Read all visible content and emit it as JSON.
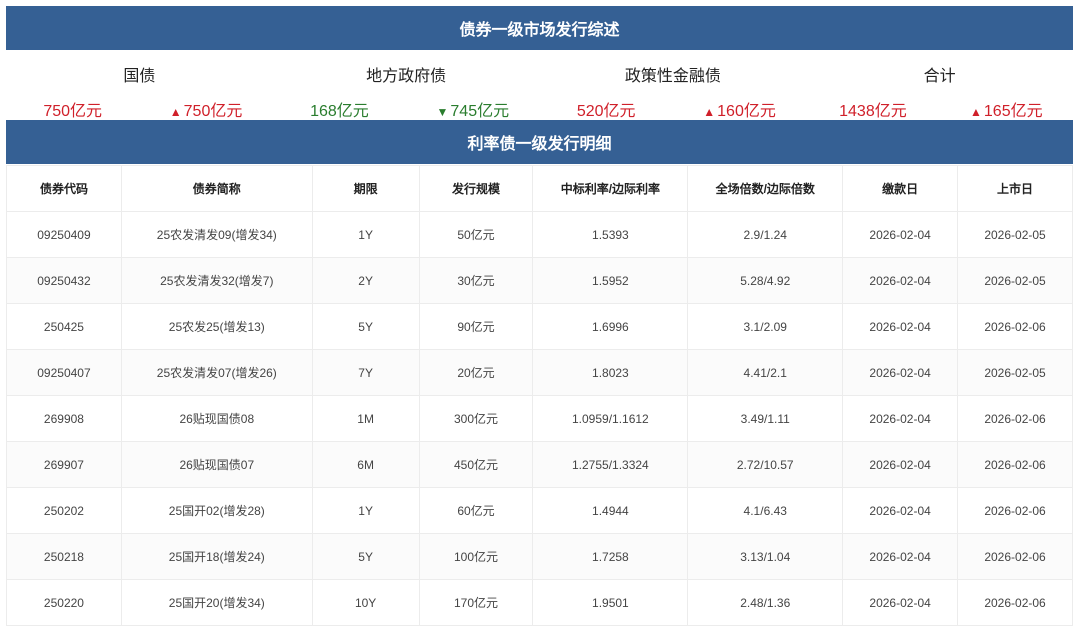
{
  "overview": {
    "title": "债券一级市场发行综述",
    "categories": [
      {
        "label": "国债",
        "amount": "750亿元",
        "amount_color": "red",
        "change": "750亿元",
        "direction": "up"
      },
      {
        "label": "地方政府债",
        "amount": "168亿元",
        "amount_color": "green",
        "change": "745亿元",
        "direction": "down"
      },
      {
        "label": "政策性金融债",
        "amount": "520亿元",
        "amount_color": "red",
        "change": "160亿元",
        "direction": "up"
      },
      {
        "label": "合计",
        "amount": "1438亿元",
        "amount_color": "red",
        "change": "165亿元",
        "direction": "up"
      }
    ]
  },
  "colors": {
    "header": "#356094",
    "up": "#d0202a",
    "down": "#2a7d2e"
  },
  "detail": {
    "title": "利率债一级发行明细",
    "columns": [
      "债券代码",
      "债券简称",
      "期限",
      "发行规模",
      "中标利率/边际利率",
      "全场倍数/边际倍数",
      "缴款日",
      "上市日"
    ],
    "rows": [
      [
        "09250409",
        "25农发清发09(增发34)",
        "1Y",
        "50亿元",
        "1.5393",
        "2.9/1.24",
        "2026-02-04",
        "2026-02-05"
      ],
      [
        "09250432",
        "25农发清发32(增发7)",
        "2Y",
        "30亿元",
        "1.5952",
        "5.28/4.92",
        "2026-02-04",
        "2026-02-05"
      ],
      [
        "250425",
        "25农发25(增发13)",
        "5Y",
        "90亿元",
        "1.6996",
        "3.1/2.09",
        "2026-02-04",
        "2026-02-06"
      ],
      [
        "09250407",
        "25农发清发07(增发26)",
        "7Y",
        "20亿元",
        "1.8023",
        "4.41/2.1",
        "2026-02-04",
        "2026-02-05"
      ],
      [
        "269908",
        "26贴现国债08",
        "1M",
        "300亿元",
        "1.0959/1.1612",
        "3.49/1.11",
        "2026-02-04",
        "2026-02-06"
      ],
      [
        "269907",
        "26贴现国债07",
        "6M",
        "450亿元",
        "1.2755/1.3324",
        "2.72/10.57",
        "2026-02-04",
        "2026-02-06"
      ],
      [
        "250202",
        "25国开02(增发28)",
        "1Y",
        "60亿元",
        "1.4944",
        "4.1/6.43",
        "2026-02-04",
        "2026-02-06"
      ],
      [
        "250218",
        "25国开18(增发24)",
        "5Y",
        "100亿元",
        "1.7258",
        "3.13/1.04",
        "2026-02-04",
        "2026-02-06"
      ],
      [
        "250220",
        "25国开20(增发34)",
        "10Y",
        "170亿元",
        "1.9501",
        "2.48/1.36",
        "2026-02-04",
        "2026-02-06"
      ]
    ]
  }
}
